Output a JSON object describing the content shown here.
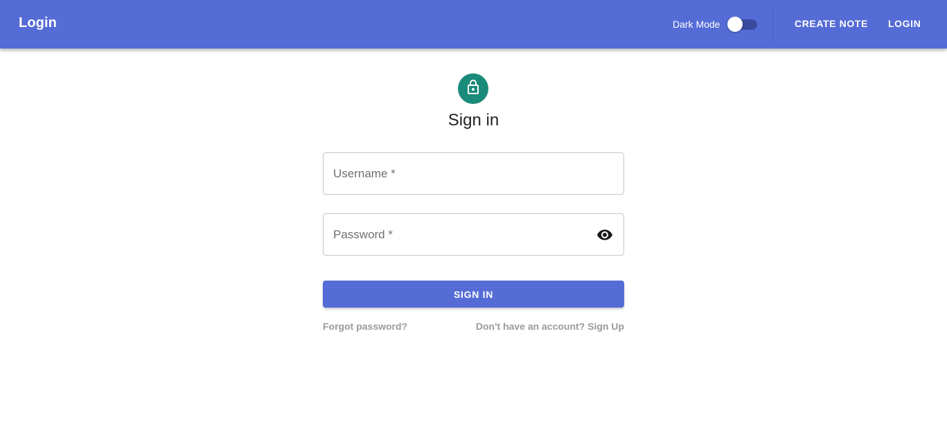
{
  "appbar": {
    "title": "Login",
    "dark_mode_label": "Dark Mode",
    "dark_mode_on": false,
    "nav": {
      "create_note": "CREATE NOTE",
      "login": "LOGIN"
    },
    "color": "#556cd6"
  },
  "form": {
    "icon": "lock-icon",
    "title": "Sign in",
    "username_placeholder": "Username *",
    "username_value": "",
    "password_placeholder": "Password *",
    "password_value": "",
    "password_toggle_icon": "eye-icon",
    "submit_label": "SIGN IN",
    "forgot_password": "Forgot password?",
    "signup": "Don't have an account? Sign Up"
  },
  "colors": {
    "primary": "#556cd6",
    "avatar": "#1a8a7a",
    "link": "#9a9a9a"
  }
}
